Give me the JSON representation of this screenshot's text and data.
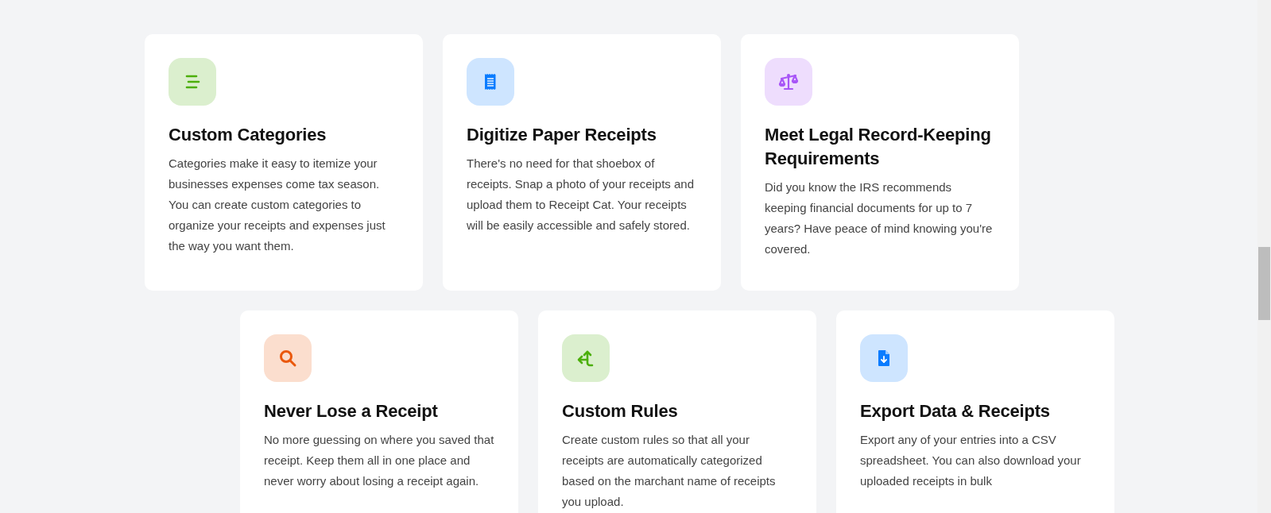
{
  "rows": [
    {
      "cards": [
        {
          "kind": "categories",
          "color": "#4caf0a",
          "title": "Custom Categories",
          "description": "Categories make it easy to itemize your businesses expenses come tax season. You can create custom categories to organize your receipts and expenses just the way you want them."
        },
        {
          "kind": "receipt",
          "color": "#0a7cff",
          "title": "Digitize Paper Receipts",
          "description": "There's no need for that shoebox of receipts. Snap a photo of your receipts and upload them to Receipt Cat. Your receipts will be easily accessible and safely stored."
        },
        {
          "kind": "scale",
          "color": "#a855f7",
          "title": "Meet Legal Record-Keeping Requirements",
          "description": "Did you know the IRS recommends keeping financial documents for up to 7 years? Have peace of mind knowing you're covered."
        }
      ]
    },
    {
      "cards": [
        {
          "kind": "search",
          "color": "#ea580c",
          "title": "Never Lose a Receipt",
          "description": "No more guessing on where you saved that receipt. Keep them all in one place and never worry about losing a receipt again."
        },
        {
          "kind": "split",
          "color": "#4caf0a",
          "title": "Custom Rules",
          "description": "Create custom rules so that all your receipts are automatically categorized based on the marchant name of receipts you upload."
        },
        {
          "kind": "file-download",
          "color": "#0a7cff",
          "title": "Export Data & Receipts",
          "description": "Export any of your entries into a CSV spreadsheet. You can also download your uploaded receipts in bulk"
        }
      ]
    }
  ]
}
